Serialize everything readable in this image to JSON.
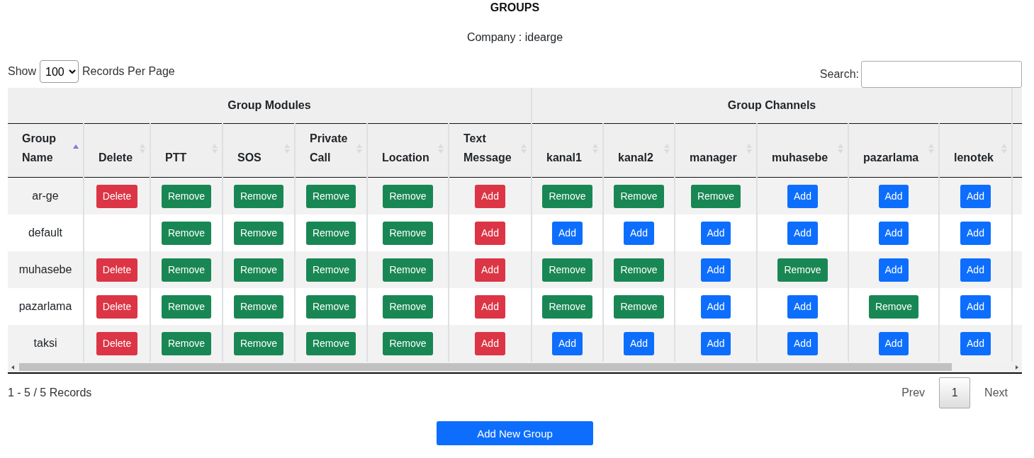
{
  "title": "GROUPS",
  "company": "Company : idearge",
  "length": {
    "before": "Show",
    "value": "100",
    "after": "Records Per Page"
  },
  "search": {
    "label": "Search:"
  },
  "table": {
    "groups": [
      "Group Modules",
      "Group Channels"
    ],
    "columns": [
      {
        "label": "Group Name",
        "sorted": true
      },
      {
        "label": "Delete",
        "sorted": false
      },
      {
        "label": "PTT",
        "sorted": false
      },
      {
        "label": "SOS",
        "sorted": false
      },
      {
        "label": "Private Call",
        "sorted": false
      },
      {
        "label": "Location",
        "sorted": false
      },
      {
        "label": "Text Message",
        "sorted": false
      },
      {
        "label": "kanal1",
        "sorted": false
      },
      {
        "label": "kanal2",
        "sorted": false
      },
      {
        "label": "manager",
        "sorted": false
      },
      {
        "label": "muhasebe",
        "sorted": false
      },
      {
        "label": "pazarlama",
        "sorted": false
      },
      {
        "label": "lenotek",
        "sorted": false
      }
    ],
    "rows": [
      {
        "cells": [
          {
            "label": "ar-ge",
            "kind": "text"
          },
          {
            "label": "Delete",
            "kind": "danger"
          },
          {
            "label": "Remove",
            "kind": "success"
          },
          {
            "label": "Remove",
            "kind": "success"
          },
          {
            "label": "Remove",
            "kind": "success"
          },
          {
            "label": "Remove",
            "kind": "success"
          },
          {
            "label": "Add",
            "kind": "danger"
          },
          {
            "label": "Remove",
            "kind": "success"
          },
          {
            "label": "Remove",
            "kind": "success"
          },
          {
            "label": "Remove",
            "kind": "success"
          },
          {
            "label": "Add",
            "kind": "primary"
          },
          {
            "label": "Add",
            "kind": "primary"
          },
          {
            "label": "Add",
            "kind": "primary"
          }
        ]
      },
      {
        "cells": [
          {
            "label": "default",
            "kind": "text"
          },
          {
            "kind": "empty"
          },
          {
            "label": "Remove",
            "kind": "success"
          },
          {
            "label": "Remove",
            "kind": "success"
          },
          {
            "label": "Remove",
            "kind": "success"
          },
          {
            "label": "Remove",
            "kind": "success"
          },
          {
            "label": "Add",
            "kind": "danger"
          },
          {
            "label": "Add",
            "kind": "primary"
          },
          {
            "label": "Add",
            "kind": "primary"
          },
          {
            "label": "Add",
            "kind": "primary"
          },
          {
            "label": "Add",
            "kind": "primary"
          },
          {
            "label": "Add",
            "kind": "primary"
          },
          {
            "label": "Add",
            "kind": "primary"
          }
        ]
      },
      {
        "cells": [
          {
            "label": "muhasebe",
            "kind": "text"
          },
          {
            "label": "Delete",
            "kind": "danger"
          },
          {
            "label": "Remove",
            "kind": "success"
          },
          {
            "label": "Remove",
            "kind": "success"
          },
          {
            "label": "Remove",
            "kind": "success"
          },
          {
            "label": "Remove",
            "kind": "success"
          },
          {
            "label": "Add",
            "kind": "danger"
          },
          {
            "label": "Remove",
            "kind": "success"
          },
          {
            "label": "Remove",
            "kind": "success"
          },
          {
            "label": "Add",
            "kind": "primary"
          },
          {
            "label": "Remove",
            "kind": "success"
          },
          {
            "label": "Add",
            "kind": "primary"
          },
          {
            "label": "Add",
            "kind": "primary"
          }
        ]
      },
      {
        "cells": [
          {
            "label": "pazarlama",
            "kind": "text"
          },
          {
            "label": "Delete",
            "kind": "danger"
          },
          {
            "label": "Remove",
            "kind": "success"
          },
          {
            "label": "Remove",
            "kind": "success"
          },
          {
            "label": "Remove",
            "kind": "success"
          },
          {
            "label": "Remove",
            "kind": "success"
          },
          {
            "label": "Add",
            "kind": "danger"
          },
          {
            "label": "Remove",
            "kind": "success"
          },
          {
            "label": "Remove",
            "kind": "success"
          },
          {
            "label": "Add",
            "kind": "primary"
          },
          {
            "label": "Add",
            "kind": "primary"
          },
          {
            "label": "Remove",
            "kind": "success"
          },
          {
            "label": "Add",
            "kind": "primary"
          }
        ]
      },
      {
        "cells": [
          {
            "label": "taksi",
            "kind": "text"
          },
          {
            "label": "Delete",
            "kind": "danger"
          },
          {
            "label": "Remove",
            "kind": "success"
          },
          {
            "label": "Remove",
            "kind": "success"
          },
          {
            "label": "Remove",
            "kind": "success"
          },
          {
            "label": "Remove",
            "kind": "success"
          },
          {
            "label": "Add",
            "kind": "danger"
          },
          {
            "label": "Add",
            "kind": "primary"
          },
          {
            "label": "Add",
            "kind": "primary"
          },
          {
            "label": "Add",
            "kind": "primary"
          },
          {
            "label": "Add",
            "kind": "primary"
          },
          {
            "label": "Add",
            "kind": "primary"
          },
          {
            "label": "Add",
            "kind": "primary"
          }
        ]
      }
    ]
  },
  "info": "1 - 5 / 5 Records",
  "pagination": {
    "prev": "Prev",
    "pages": [
      {
        "label": "1",
        "selected": true
      }
    ],
    "next": "Next"
  },
  "add_button": "Add New Group"
}
